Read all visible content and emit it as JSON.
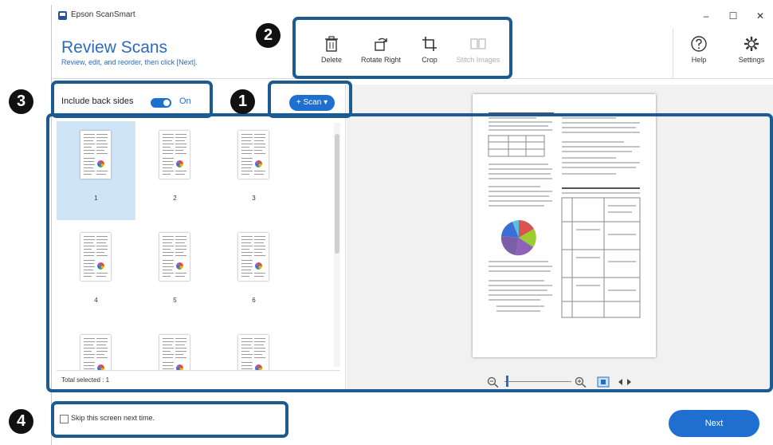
{
  "window": {
    "title": "Epson ScanSmart",
    "controls": [
      "–",
      "☐",
      "✕"
    ]
  },
  "header": {
    "title": "Review Scans",
    "subtitle": "Review, edit, and reorder, then click [Next]."
  },
  "toolbar": {
    "tools": [
      {
        "label": "Delete",
        "icon": "trash-icon",
        "enabled": true
      },
      {
        "label": "Rotate Right",
        "icon": "rotate-right-icon",
        "enabled": true
      },
      {
        "label": "Crop",
        "icon": "crop-icon",
        "enabled": true
      },
      {
        "label": "Stitch Images",
        "icon": "stitch-images-icon",
        "enabled": false
      }
    ],
    "help_label": "Help",
    "settings_label": "Settings"
  },
  "options": {
    "back_sides_label": "Include back sides",
    "back_sides_state": "On",
    "scan_button": "+ Scan ▾"
  },
  "thumbnails": [
    "1",
    "2",
    "3",
    "4",
    "5",
    "6",
    "",
    "",
    ""
  ],
  "selected_thumbnail": "1",
  "status": {
    "total_selected": "Total selected : 1"
  },
  "zoom": {
    "out_icon": "zoom-out-icon",
    "in_icon": "zoom-in-icon",
    "fit_icon": "fit-page-icon",
    "expand_icon": "expand-icon"
  },
  "footer": {
    "skip_label": "Skip this screen next time.",
    "skip_checked": false,
    "next_label": "Next"
  },
  "callouts": [
    "1",
    "2",
    "3",
    "4"
  ],
  "colors": {
    "accent": "#1f6fd1",
    "title": "#2b6bbf",
    "callout_border": "#1b5b92"
  }
}
